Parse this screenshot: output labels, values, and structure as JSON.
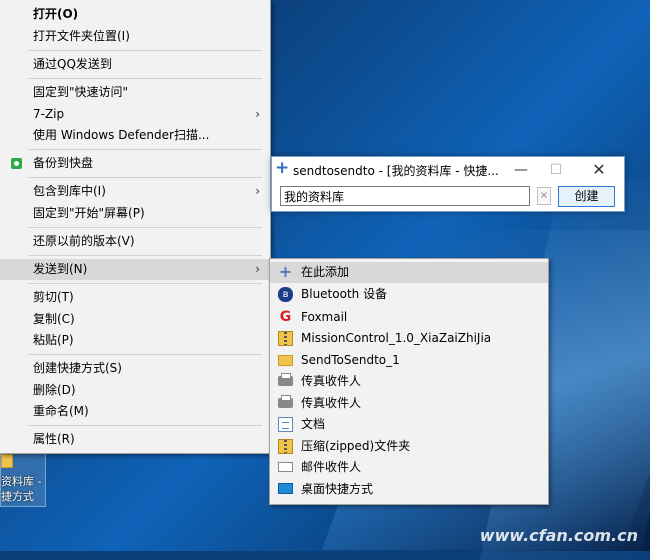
{
  "context_menu": {
    "items": [
      {
        "label": "打开(O)",
        "bold": true
      },
      {
        "label": "打开文件夹位置(I)"
      },
      {
        "label": "通过QQ发送到"
      },
      {
        "label": "固定到\"快速访问\""
      },
      {
        "label": "7-Zip",
        "submenu": true
      },
      {
        "label": "使用 Windows Defender扫描..."
      },
      {
        "label": "备份到快盘",
        "icon": "kuaipan-icon"
      },
      {
        "label": "包含到库中(I)",
        "submenu": true
      },
      {
        "label": "固定到\"开始\"屏幕(P)"
      },
      {
        "label": "还原以前的版本(V)"
      },
      {
        "label": "发送到(N)",
        "submenu": true,
        "highlighted": true
      },
      {
        "label": "剪切(T)"
      },
      {
        "label": "复制(C)"
      },
      {
        "label": "粘贴(P)"
      },
      {
        "label": "创建快捷方式(S)"
      },
      {
        "label": "删除(D)"
      },
      {
        "label": "重命名(M)"
      },
      {
        "label": "属性(R)"
      }
    ],
    "arrow_glyph": "›"
  },
  "send_to_menu": {
    "items": [
      {
        "label": "在此添加",
        "icon": "plus-icon",
        "highlighted": true
      },
      {
        "label": "Bluetooth 设备",
        "icon": "bluetooth-icon"
      },
      {
        "label": "Foxmail",
        "icon": "foxmail-icon"
      },
      {
        "label": "MissionControl_1.0_XiaZaiZhiJia",
        "icon": "zip-folder-icon"
      },
      {
        "label": "SendToSendto_1",
        "icon": "folder-icon"
      },
      {
        "label": "传真收件人",
        "icon": "fax-icon"
      },
      {
        "label": "传真收件人",
        "icon": "fax-icon"
      },
      {
        "label": "文档",
        "icon": "document-icon"
      },
      {
        "label": "压缩(zipped)文件夹",
        "icon": "zip-folder-icon"
      },
      {
        "label": "邮件收件人",
        "icon": "mail-icon"
      },
      {
        "label": "桌面快捷方式",
        "icon": "desktop-icon"
      }
    ]
  },
  "dialog": {
    "title": "sendtosendto - [我的资料库 - 快捷...",
    "input_value": "我的资料库",
    "clear_label": "×",
    "ok_label": "创建",
    "minimize_glyph": "—",
    "maximize_glyph": "☐",
    "close_glyph": "✕"
  },
  "desktop_icon": {
    "line1": "资料库 -",
    "line2": "捷方式"
  },
  "watermark": "www.cfan.com.cn",
  "colors": {
    "menu_bg": "#f2f2f2",
    "highlight": "#d8d8d8",
    "accent": "#2a7ad8"
  }
}
